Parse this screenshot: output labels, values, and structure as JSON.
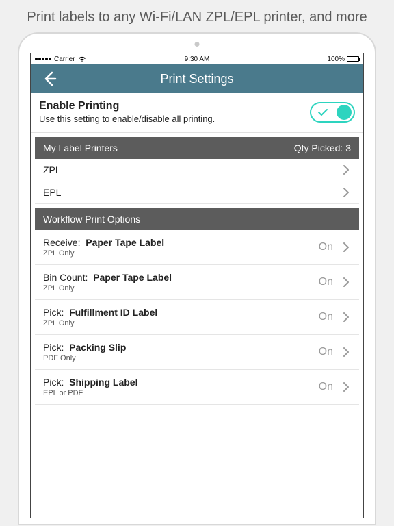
{
  "caption": "Print labels to any Wi-Fi/LAN ZPL/EPL printer, and more",
  "status": {
    "carrier": "Carrier",
    "time": "9:30 AM",
    "battery": "100%"
  },
  "header": {
    "title": "Print Settings"
  },
  "enable": {
    "title": "Enable Printing",
    "subtitle": "Use this setting to enable/disable all printing.",
    "on": true
  },
  "printers": {
    "header_label": "My Label Printers",
    "qty_label": "Qty Picked: 3",
    "items": [
      {
        "name": "ZPL"
      },
      {
        "name": "EPL"
      }
    ]
  },
  "workflow": {
    "header_label": "Workflow Print Options",
    "items": [
      {
        "prefix": "Receive:",
        "label": "Paper Tape Label",
        "sub": "ZPL Only",
        "state": "On"
      },
      {
        "prefix": "Bin Count:",
        "label": "Paper Tape Label",
        "sub": "ZPL Only",
        "state": "On"
      },
      {
        "prefix": "Pick:",
        "label": "Fulfillment ID Label",
        "sub": "ZPL Only",
        "state": "On"
      },
      {
        "prefix": "Pick:",
        "label": "Packing Slip",
        "sub": "PDF Only",
        "state": "On"
      },
      {
        "prefix": "Pick:",
        "label": "Shipping Label",
        "sub": "EPL or PDF",
        "state": "On"
      }
    ]
  }
}
